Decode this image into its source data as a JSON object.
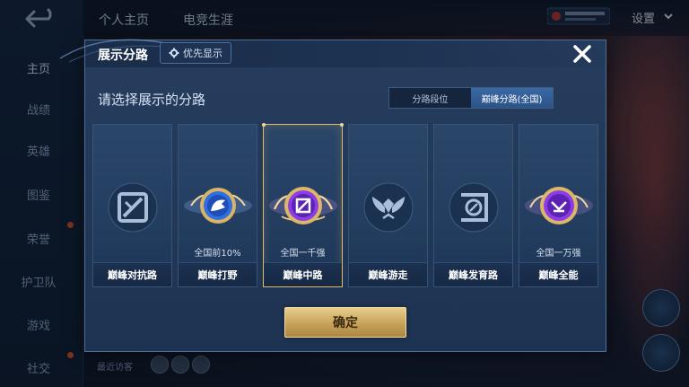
{
  "background": {
    "sidebar_items": [
      {
        "label": "主页",
        "active": true
      },
      {
        "label": "战绩",
        "active": false
      },
      {
        "label": "英雄",
        "active": false
      },
      {
        "label": "图鉴",
        "active": false
      },
      {
        "label": "荣誉",
        "active": false
      },
      {
        "label": "护卫队",
        "active": false
      },
      {
        "label": "游戏",
        "active": false
      },
      {
        "label": "社交",
        "active": false
      }
    ],
    "top_tabs": [
      "个人主页",
      "电竞生涯"
    ],
    "settings_label": "设置",
    "recent_visitors_label": "最近访客"
  },
  "modal": {
    "title": "展示分路",
    "priority_label": "优先显示",
    "subtitle": "请选择展示的分路",
    "segment": {
      "options": [
        "分路段位",
        "巅峰分路(全国)"
      ],
      "selected": "巅峰分路(全国)"
    },
    "cards": [
      {
        "name": "巅峰对抗路",
        "rank": "",
        "icon": "sword-lane-icon",
        "style": "plain"
      },
      {
        "name": "巅峰打野",
        "rank": "全国前10%",
        "icon": "wolf-jungle-icon",
        "style": "blue-gold"
      },
      {
        "name": "巅峰中路",
        "rank": "全国一千强",
        "icon": "mid-lane-icon",
        "style": "purple-gold",
        "selected": true
      },
      {
        "name": "巅峰游走",
        "rank": "",
        "icon": "wings-support-icon",
        "style": "plain"
      },
      {
        "name": "巅峰发育路",
        "rank": "",
        "icon": "target-adc-icon",
        "style": "plain"
      },
      {
        "name": "巅峰全能",
        "rank": "全国一万强",
        "icon": "allround-icon",
        "style": "purple-gold"
      }
    ],
    "confirm_label": "确定"
  },
  "colors": {
    "accent_gold": "#e3b96a",
    "modal_bg": "#243b5b",
    "segment_active": "#3a6aa5"
  }
}
